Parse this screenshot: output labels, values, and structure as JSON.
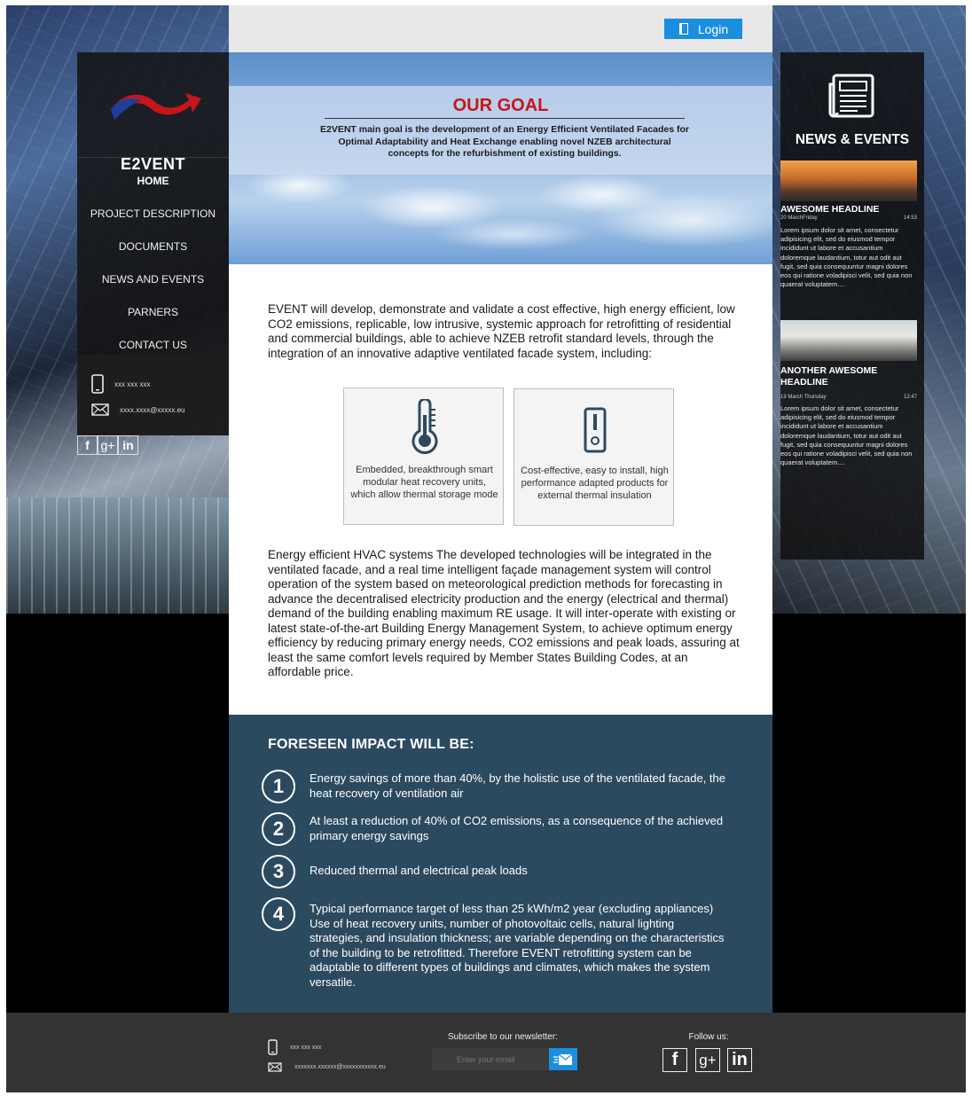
{
  "header": {
    "login_label": "Login"
  },
  "brand": {
    "name": "E2VENT"
  },
  "nav": {
    "items": [
      {
        "label": "HOME"
      },
      {
        "label": "PROJECT DESCRIPTION"
      },
      {
        "label": "DOCUMENTS"
      },
      {
        "label": "NEWS AND EVENTS"
      },
      {
        "label": "PARNERS"
      },
      {
        "label": "CONTACT US"
      }
    ],
    "phone": "xxx xxx xxx",
    "email": "xxxx.xxxx@xxxxx.eu"
  },
  "hero": {
    "title": "OUR GOAL",
    "text": "E2VENT main goal is the development of an Energy Efficient Ventilated Facades for Optimal Adaptability and Heat Exchange enabling novel NZEB architectural concepts for the refurbishment of existing buildings."
  },
  "intro": "EVENT will develop, demonstrate and validate a cost effective, high energy efficient, low CO2 emissions, replicable, low intrusive, systemic approach for retrofitting of residential and commercial buildings, able to achieve NZEB retrofit standard levels, through the integration of an innovative adaptive ventilated facade system, including:",
  "features": [
    {
      "icon": "thermometer-icon",
      "text": "Embedded, breakthrough smart modular heat recovery units, which allow thermal storage mode"
    },
    {
      "icon": "panel-switch-icon",
      "text": "Cost-effective, easy to install, high performance adapted products for external thermal insulation"
    }
  ],
  "body2": "Energy efficient HVAC systems The developed technologies will be integrated in the ventilated facade, and a real time intelligent façade management system will control operation of the system based on meteorological prediction methods for forecasting in advance the decentralised electricity production and the energy (electrical and thermal) demand of the building enabling maximum RE usage. It will inter-operate with existing or latest state-of-the-art Building Energy Management System, to achieve optimum energy efficiency by reducing primary energy needs, CO2 emissions and peak loads, assuring at least the same comfort levels required by Member States Building Codes, at an affordable price.",
  "impact": {
    "title": "FORESEEN IMPACT WILL BE:",
    "items": [
      {
        "num": "1",
        "text": "Energy savings of more than 40%, by the holistic use of the ventilated facade, the heat recovery of ventilation air"
      },
      {
        "num": "2",
        "text": "At least a reduction of 40% of CO2 emissions, as a consequence of the achieved primary energy savings"
      },
      {
        "num": "3",
        "text": "Reduced thermal and electrical peak loads"
      },
      {
        "num": "4",
        "text": "Typical performance target of less than 25 kWh/m2 year (excluding appliances) Use of heat recovery units, number of photovoltaic cells, natural lighting strategies, and insulation thickness; are variable depending on the characteristics of the building to be retrofitted. Therefore EVENT retrofitting system can be adaptable to different types of buildings and climates, which makes the system versatile."
      }
    ]
  },
  "news": {
    "title": "NEWS & EVENTS",
    "items": [
      {
        "headline": "AWESOME HEADLINE",
        "date": "20 MarchFriday",
        "time": "14:53",
        "body": "Lorem ipsum dolor sit amet, consectetur adipisicing elit, sed do eiusmod tempor incididunt ut labore et accusantium doloremque laudantium, totur aut odit aut fugit, sed quia consequuntur magni dolores eos qui ratione voladipisci velit, sed quia non quaerat voluptatem...."
      },
      {
        "headline": "ANOTHER AWESOME HEADLINE",
        "date": "19 March Thursday",
        "time": "12:47",
        "body": "Lorem ipsum dolor sit amet, consectetur adipisicing elit, sed do eiusmod tempor incididunt ut labore et accusantium doloremque laudantium, totur aut odit aut fugit, sed quia consequuntur magni dolores eos qui ratione voladipisci velit, sed quia non quaerat voluptatem...."
      }
    ]
  },
  "footer": {
    "phone": "xxx xxx xxx",
    "email": "xxxxxxx.xxxxxx@xxxxxxxxxxx.eu",
    "newsletter_label": "Subscribe to our newsletter:",
    "email_placeholder": "Enter your email",
    "follow_label": "Follow us:"
  },
  "colors": {
    "accent": "#1a8fe0",
    "goal_title": "#c8151b",
    "impact_bg": "#2c4a5f",
    "footer_bg": "#333333"
  }
}
